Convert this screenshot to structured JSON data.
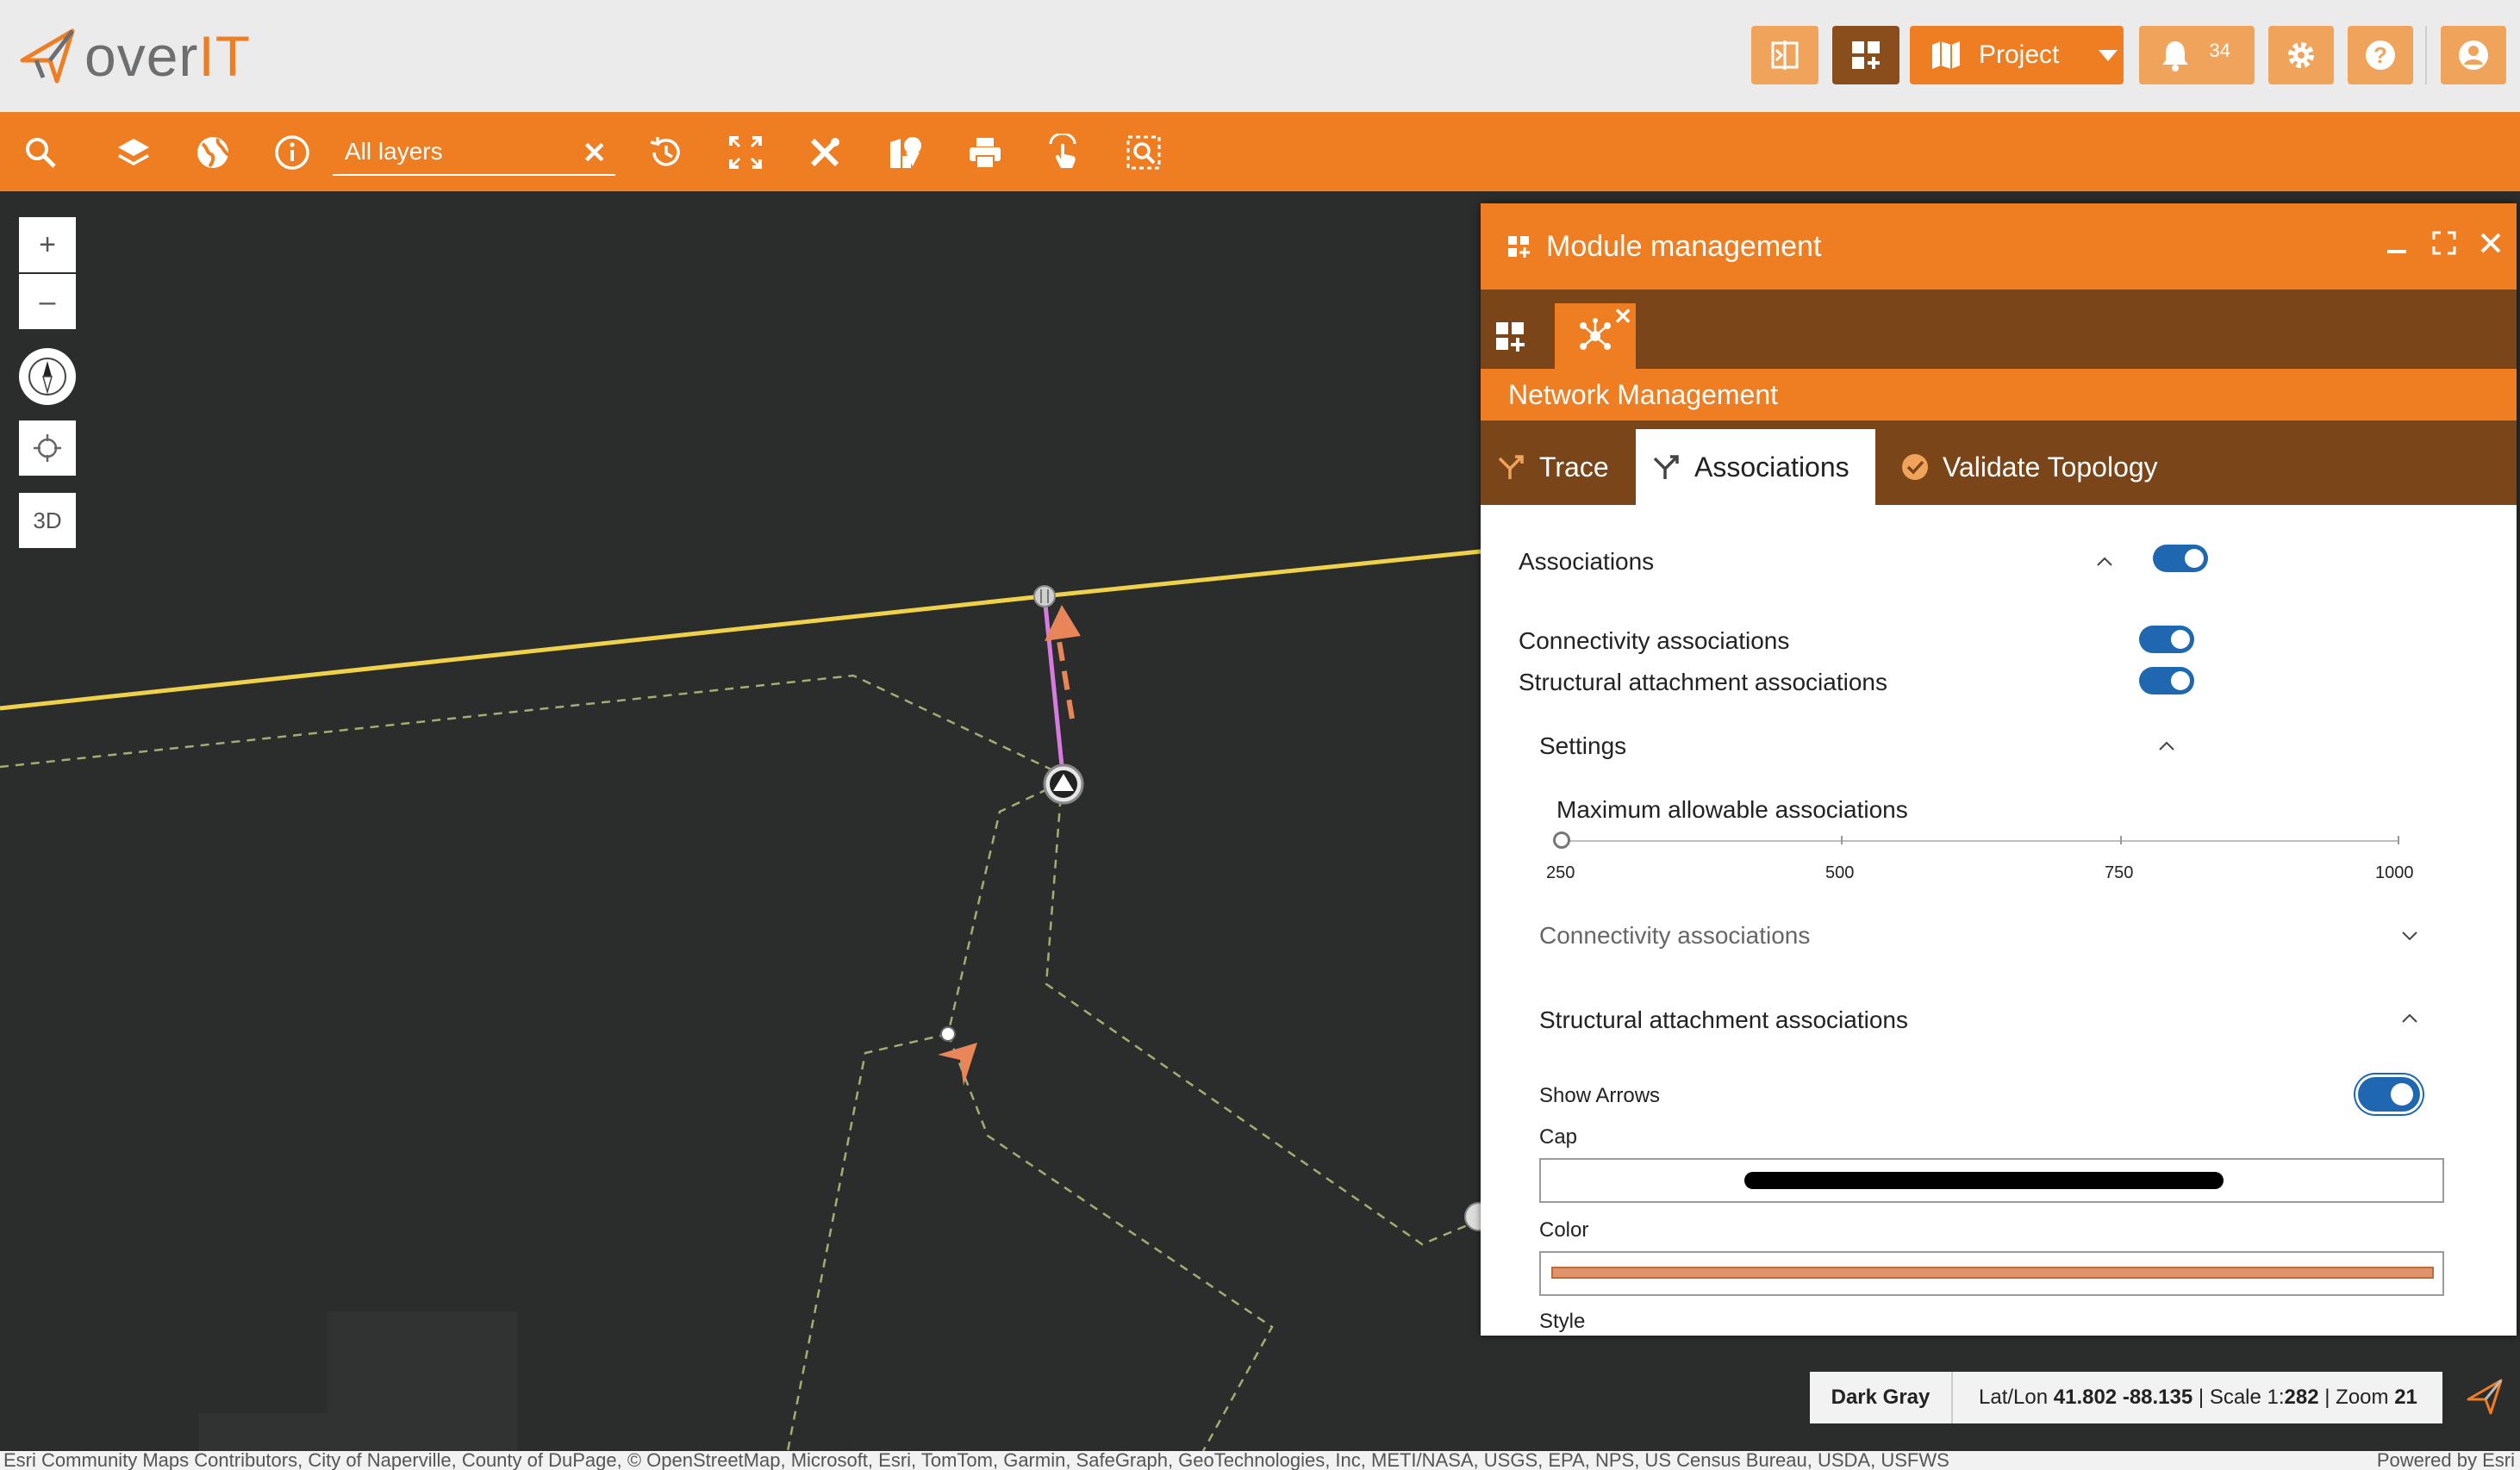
{
  "header": {
    "logo_text_prefix": "over",
    "logo_text_suffix": "IT",
    "project_label": "Project",
    "notifications_count": "34"
  },
  "toolbar": {
    "layer_filter_value": "All layers"
  },
  "map_controls": {
    "zoom_in": "+",
    "zoom_out": "–",
    "three_d": "3D"
  },
  "status_bar": {
    "basemap": "Dark Gray",
    "latlon_label": "Lat/Lon",
    "lat": "41.802",
    "lon": "-88.135",
    "scale_label": "Scale 1:",
    "scale_value": "282",
    "zoom_label": "Zoom",
    "zoom_value": "21"
  },
  "attribution": {
    "text": "Esri Community Maps Contributors, City of Naperville, County of DuPage, © OpenStreetMap, Microsoft, Esri, TomTom, Garmin, SafeGraph, GeoTechnologies, Inc, METI/NASA, USGS, EPA, NPS, US Census Bureau, USDA, USFWS",
    "powered_by": "Powered by Esri"
  },
  "panel": {
    "title": "Module management",
    "module_title": "Network Management",
    "tabs": [
      {
        "label": "Trace"
      },
      {
        "label": "Associations"
      },
      {
        "label": "Validate Topology"
      }
    ],
    "associations": {
      "heading": "Associations",
      "connectivity_label": "Connectivity associations",
      "structural_label": "Structural attachment associations",
      "settings_heading": "Settings",
      "max_label": "Maximum allowable associations",
      "slider_ticks": [
        "250",
        "500",
        "750",
        "1000"
      ],
      "slider_value": 250,
      "connectivity_section": "Connectivity associations",
      "structural_section": "Structural attachment associations",
      "show_arrows_label": "Show Arrows",
      "cap_label": "Cap",
      "color_label": "Color",
      "style_label": "Style"
    }
  },
  "colors": {
    "brand_orange": "#ef7d22",
    "panel_dark": "#7a4518",
    "toggle_blue": "#1f67b1",
    "road_yellow": "#f0d24a",
    "association_pink": "#d77be0",
    "arrow_orange": "#e8865a"
  }
}
